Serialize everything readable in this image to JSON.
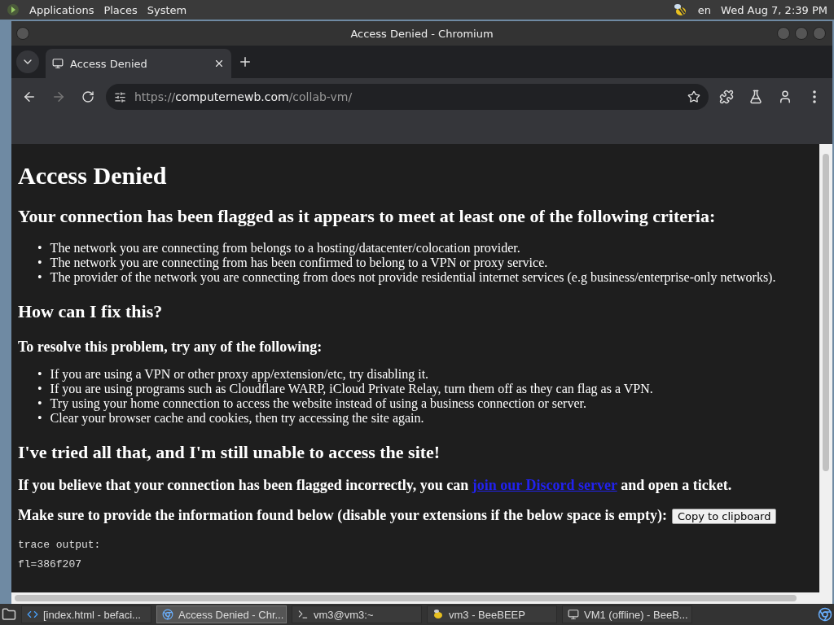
{
  "top_panel": {
    "menus": [
      "Applications",
      "Places",
      "System"
    ],
    "language": "en",
    "clock": "Wed Aug 7, 2:39 PM"
  },
  "window": {
    "title": "Access Denied - Chromium"
  },
  "tabs": [
    {
      "label": "Access Denied",
      "selected": true
    }
  ],
  "address": {
    "scheme": "https://",
    "host": "computernewb.com",
    "path": "/collab-vm/"
  },
  "content": [
    {
      "kind": "h1",
      "text": "Access Denied"
    },
    {
      "kind": "h2",
      "text": "Your connection has been flagged as it appears to meet at least one of the following criteria:"
    },
    {
      "kind": "list",
      "marker": "•",
      "items": [
        "The network you are connecting from belongs to a hosting/datacenter/colocation provider.",
        "The network you are connecting from has been confirmed to belong to a VPN or proxy service.",
        "The provider of the network you are connecting from does not provide residential internet services (e.g business/enterprise-only networks)."
      ]
    },
    {
      "kind": "h2",
      "text": "How can I fix this?"
    },
    {
      "kind": "h3",
      "text": "To resolve this problem, try any of the following:"
    },
    {
      "kind": "list",
      "marker": "•",
      "items": [
        "If you are using a VPN or other proxy app/extension/etc, try disabling it.",
        "If you are using programs such as Cloudflare WARP, iCloud Private Relay, turn them off as they can flag as a VPN.",
        "Try using your home connection to access the website instead of using a business connection or server.",
        "Clear your browser cache and cookies, then try accessing the site again."
      ]
    },
    {
      "kind": "h2",
      "text": "I've tried all that, and I'm still unable to access the site!"
    },
    {
      "kind": "link_para",
      "before": "If you believe that your connection has been flagged incorrectly, you can",
      "link": "join our Discord server",
      "after": "and open a ticket."
    },
    {
      "kind": "button_para",
      "text": "Make sure to provide the information found below (disable your extensions if the below space is empty):",
      "button": "Copy to clipboard"
    },
    {
      "kind": "pre",
      "lines": [
        "trace output:",
        "fl=386f207"
      ]
    }
  ],
  "taskbar": [
    {
      "label": "[index.html - befaci...",
      "selected": false
    },
    {
      "label": "Access Denied - Chr...",
      "selected": true
    },
    {
      "label": "vm3@vm3:~",
      "selected": false
    },
    {
      "label": "vm3 - BeeBEEP",
      "selected": false
    },
    {
      "label": "VM1 (offline) - BeeB...",
      "selected": false
    }
  ]
}
